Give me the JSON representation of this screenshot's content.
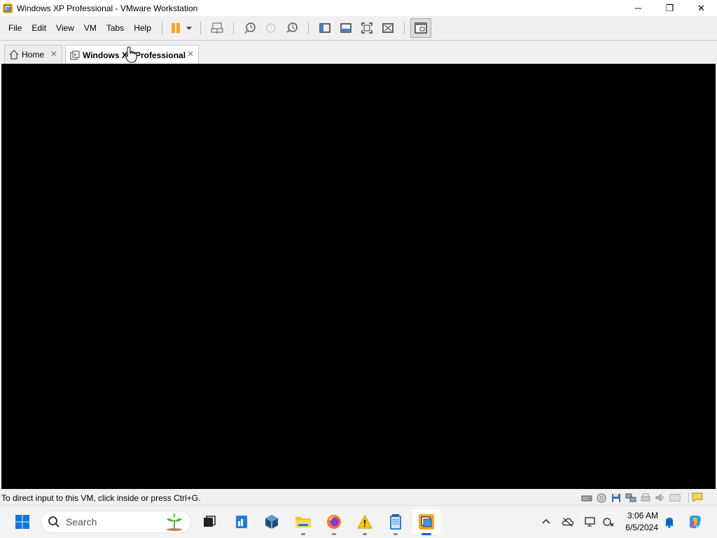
{
  "window": {
    "title": "Windows XP Professional - VMware Workstation",
    "controls": {
      "minimize": "─",
      "maximize": "❐",
      "close": "✕"
    }
  },
  "menu": [
    "File",
    "Edit",
    "View",
    "VM",
    "Tabs",
    "Help"
  ],
  "toolbar": {
    "icons": [
      "pause-icon",
      "dropdown-arrow-icon",
      "send-ctrl-alt-del-icon",
      "snapshot-take-icon",
      "snapshot-revert-icon",
      "snapshot-manager-icon",
      "show-library-icon",
      "thumbnail-bar-icon",
      "full-screen-icon",
      "unity-icon",
      "console-view-icon"
    ]
  },
  "tabs": [
    {
      "label": "Home",
      "icon": "home-icon",
      "active": false
    },
    {
      "label": "Windows XP Professional",
      "icon": "vm-icon",
      "active": true
    }
  ],
  "status": {
    "message": "To direct input to this VM, click inside or press Ctrl+G.",
    "device_icons": [
      "hard-disk-icon",
      "cd-dvd-icon",
      "floppy-icon",
      "network-adapter-icon",
      "printer-icon",
      "sound-card-icon",
      "display-icon",
      "message-log-icon"
    ]
  },
  "taskbar": {
    "search_placeholder": "Search",
    "apps": [
      "start-icon",
      "task-view-icon",
      "file-explorer-icon-blue",
      "virtualbox-icon",
      "file-explorer-icon",
      "firefox-icon",
      "warning-app-icon",
      "notepad-icon",
      "vmware-icon"
    ],
    "time": "3:06 AM",
    "date": "6/5/2024"
  },
  "colors": {
    "accent": "#0067c0",
    "vm_background": "#000000",
    "toolbar_orange": "#f5a623"
  }
}
